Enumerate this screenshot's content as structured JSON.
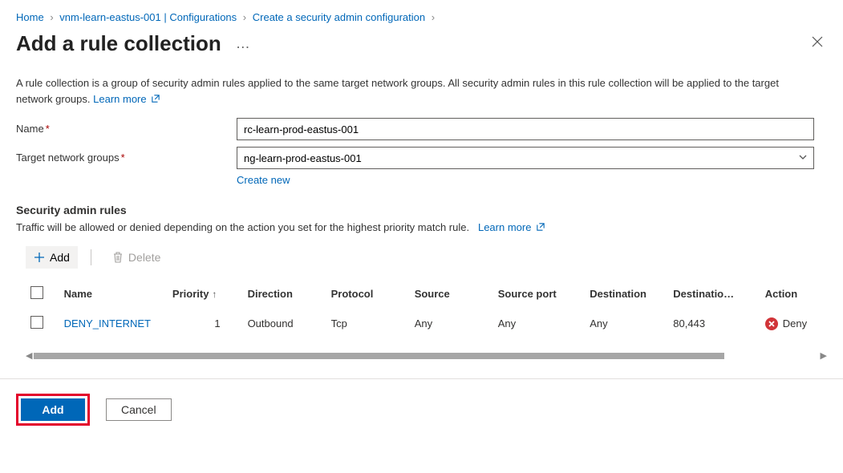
{
  "breadcrumb": {
    "home": "Home",
    "level1": "vnm-learn-eastus-001 | Configurations",
    "level2": "Create a security admin configuration"
  },
  "page_title": "Add a rule collection",
  "description": {
    "text": "A rule collection is a group of security admin rules applied to the same target network groups. All security admin rules in this rule collection will be applied to the target network groups.",
    "learn_more": "Learn more"
  },
  "form": {
    "name_label": "Name",
    "name_value": "rc-learn-prod-eastus-001",
    "groups_label": "Target network groups",
    "groups_value": "ng-learn-prod-eastus-001",
    "create_new": "Create new"
  },
  "rules_section": {
    "title": "Security admin rules",
    "desc": "Traffic will be allowed or denied depending on the action you set for the highest priority match rule.",
    "learn_more": "Learn more"
  },
  "toolbar": {
    "add": "Add",
    "delete": "Delete"
  },
  "columns": {
    "name": "Name",
    "priority": "Priority",
    "direction": "Direction",
    "protocol": "Protocol",
    "source": "Source",
    "source_port": "Source port",
    "destination": "Destination",
    "dest_port": "Destinatio…",
    "action": "Action"
  },
  "rows": [
    {
      "name": "DENY_INTERNET",
      "priority": "1",
      "direction": "Outbound",
      "protocol": "Tcp",
      "source": "Any",
      "source_port": "Any",
      "destination": "Any",
      "dest_port": "80,443",
      "action": "Deny"
    }
  ],
  "footer": {
    "add": "Add",
    "cancel": "Cancel"
  }
}
